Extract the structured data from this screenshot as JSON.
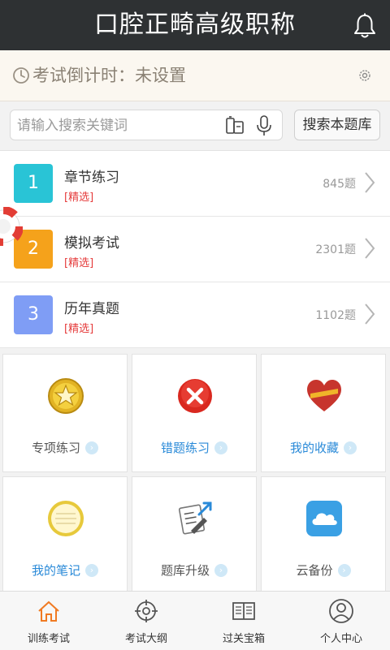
{
  "header": {
    "title": "口腔正畸高级职称"
  },
  "countdown": {
    "text": "考试倒计时：未设置"
  },
  "search": {
    "placeholder": "请输入搜索关键词",
    "button_label": "搜索本题库"
  },
  "items": [
    {
      "num": "1",
      "title": "章节练习",
      "tag": "[精选]",
      "count": "845题",
      "color": "#29c4d6"
    },
    {
      "num": "2",
      "title": "模拟考试",
      "tag": "[精选]",
      "count": "2301题",
      "color": "#f5a21b"
    },
    {
      "num": "3",
      "title": "历年真题",
      "tag": "[精选]",
      "count": "1102题",
      "color": "#7f9df5"
    }
  ],
  "tiles": [
    {
      "label": "专项练习",
      "label_color": "#555555",
      "icon": "star-medal-icon"
    },
    {
      "label": "错题练习",
      "label_color": "#2a8ad8",
      "icon": "wrong-answer-icon"
    },
    {
      "label": "我的收藏",
      "label_color": "#2a8ad8",
      "icon": "heart-favorite-icon"
    },
    {
      "label": "我的笔记",
      "label_color": "#2a8ad8",
      "icon": "notebook-icon"
    },
    {
      "label": "题库升级",
      "label_color": "#555555",
      "icon": "upgrade-checklist-icon"
    },
    {
      "label": "云备份",
      "label_color": "#555555",
      "icon": "cloud-backup-icon"
    }
  ],
  "tabbar": {
    "active_color": "#f07a22",
    "tabs": [
      {
        "label": "训练考试",
        "icon": "home-icon"
      },
      {
        "label": "考试大纲",
        "icon": "target-icon"
      },
      {
        "label": "过关宝箱",
        "icon": "book-icon"
      },
      {
        "label": "个人中心",
        "icon": "user-icon"
      }
    ]
  }
}
